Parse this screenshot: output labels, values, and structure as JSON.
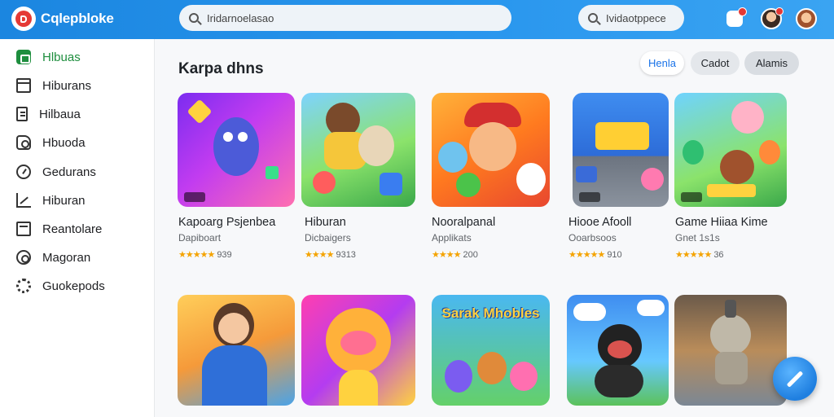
{
  "header": {
    "app_title": "Cqlepbloke",
    "search_main_placeholder": "Iridarnoelasao",
    "search_small_placeholder": "Ividaotppece"
  },
  "sidebar": {
    "items": [
      {
        "label": "Hlbuas",
        "icon": "home-icon",
        "active": true
      },
      {
        "label": "Hiburans",
        "icon": "box-icon",
        "active": false
      },
      {
        "label": "Hilbaua",
        "icon": "document-icon",
        "active": false
      },
      {
        "label": "Hbuoda",
        "icon": "puzzle-icon",
        "active": false
      },
      {
        "label": "Gedurans",
        "icon": "gauge-icon",
        "active": false
      },
      {
        "label": "Hiburan",
        "icon": "chart-icon",
        "active": false
      },
      {
        "label": "Reantolare",
        "icon": "window-icon",
        "active": false
      },
      {
        "label": "Magoran",
        "icon": "gear-icon",
        "active": false
      },
      {
        "label": "Guokepods",
        "icon": "cog-icon",
        "active": false
      }
    ]
  },
  "main": {
    "title": "Karpa dhns",
    "filters": [
      "Henla",
      "Cadot",
      "Alamis"
    ]
  },
  "cards_row1": [
    {
      "title": "Kapoarg Psjenbea",
      "sub": "Dapiboart",
      "stars": "★★★★★",
      "rating": "939"
    },
    {
      "title": "Hiburan",
      "sub": "Dicbaigers",
      "stars": "★★★★",
      "rating": "9313"
    },
    {
      "title": "Nooralpanal",
      "sub": "Applikats",
      "stars": "★★★★",
      "rating": "200"
    },
    {
      "title": "Hiooe Afooll",
      "sub": "Ooarbsoos",
      "stars": "★★★★★",
      "rating": "910"
    },
    {
      "title": "Game Hiiaa Kime",
      "sub": "Gnet 1s1s",
      "stars": "★★★★★",
      "rating": "36"
    }
  ],
  "cards_row2": [
    {
      "thumb_text": ""
    },
    {
      "thumb_text": ""
    },
    {
      "thumb_text": "Sarak Mhobles"
    },
    {
      "thumb_text": ""
    },
    {
      "thumb_text": ""
    }
  ],
  "colors": {
    "header": "#2a97ee",
    "active_green": "#1e8e3e",
    "star": "#f4a300"
  }
}
